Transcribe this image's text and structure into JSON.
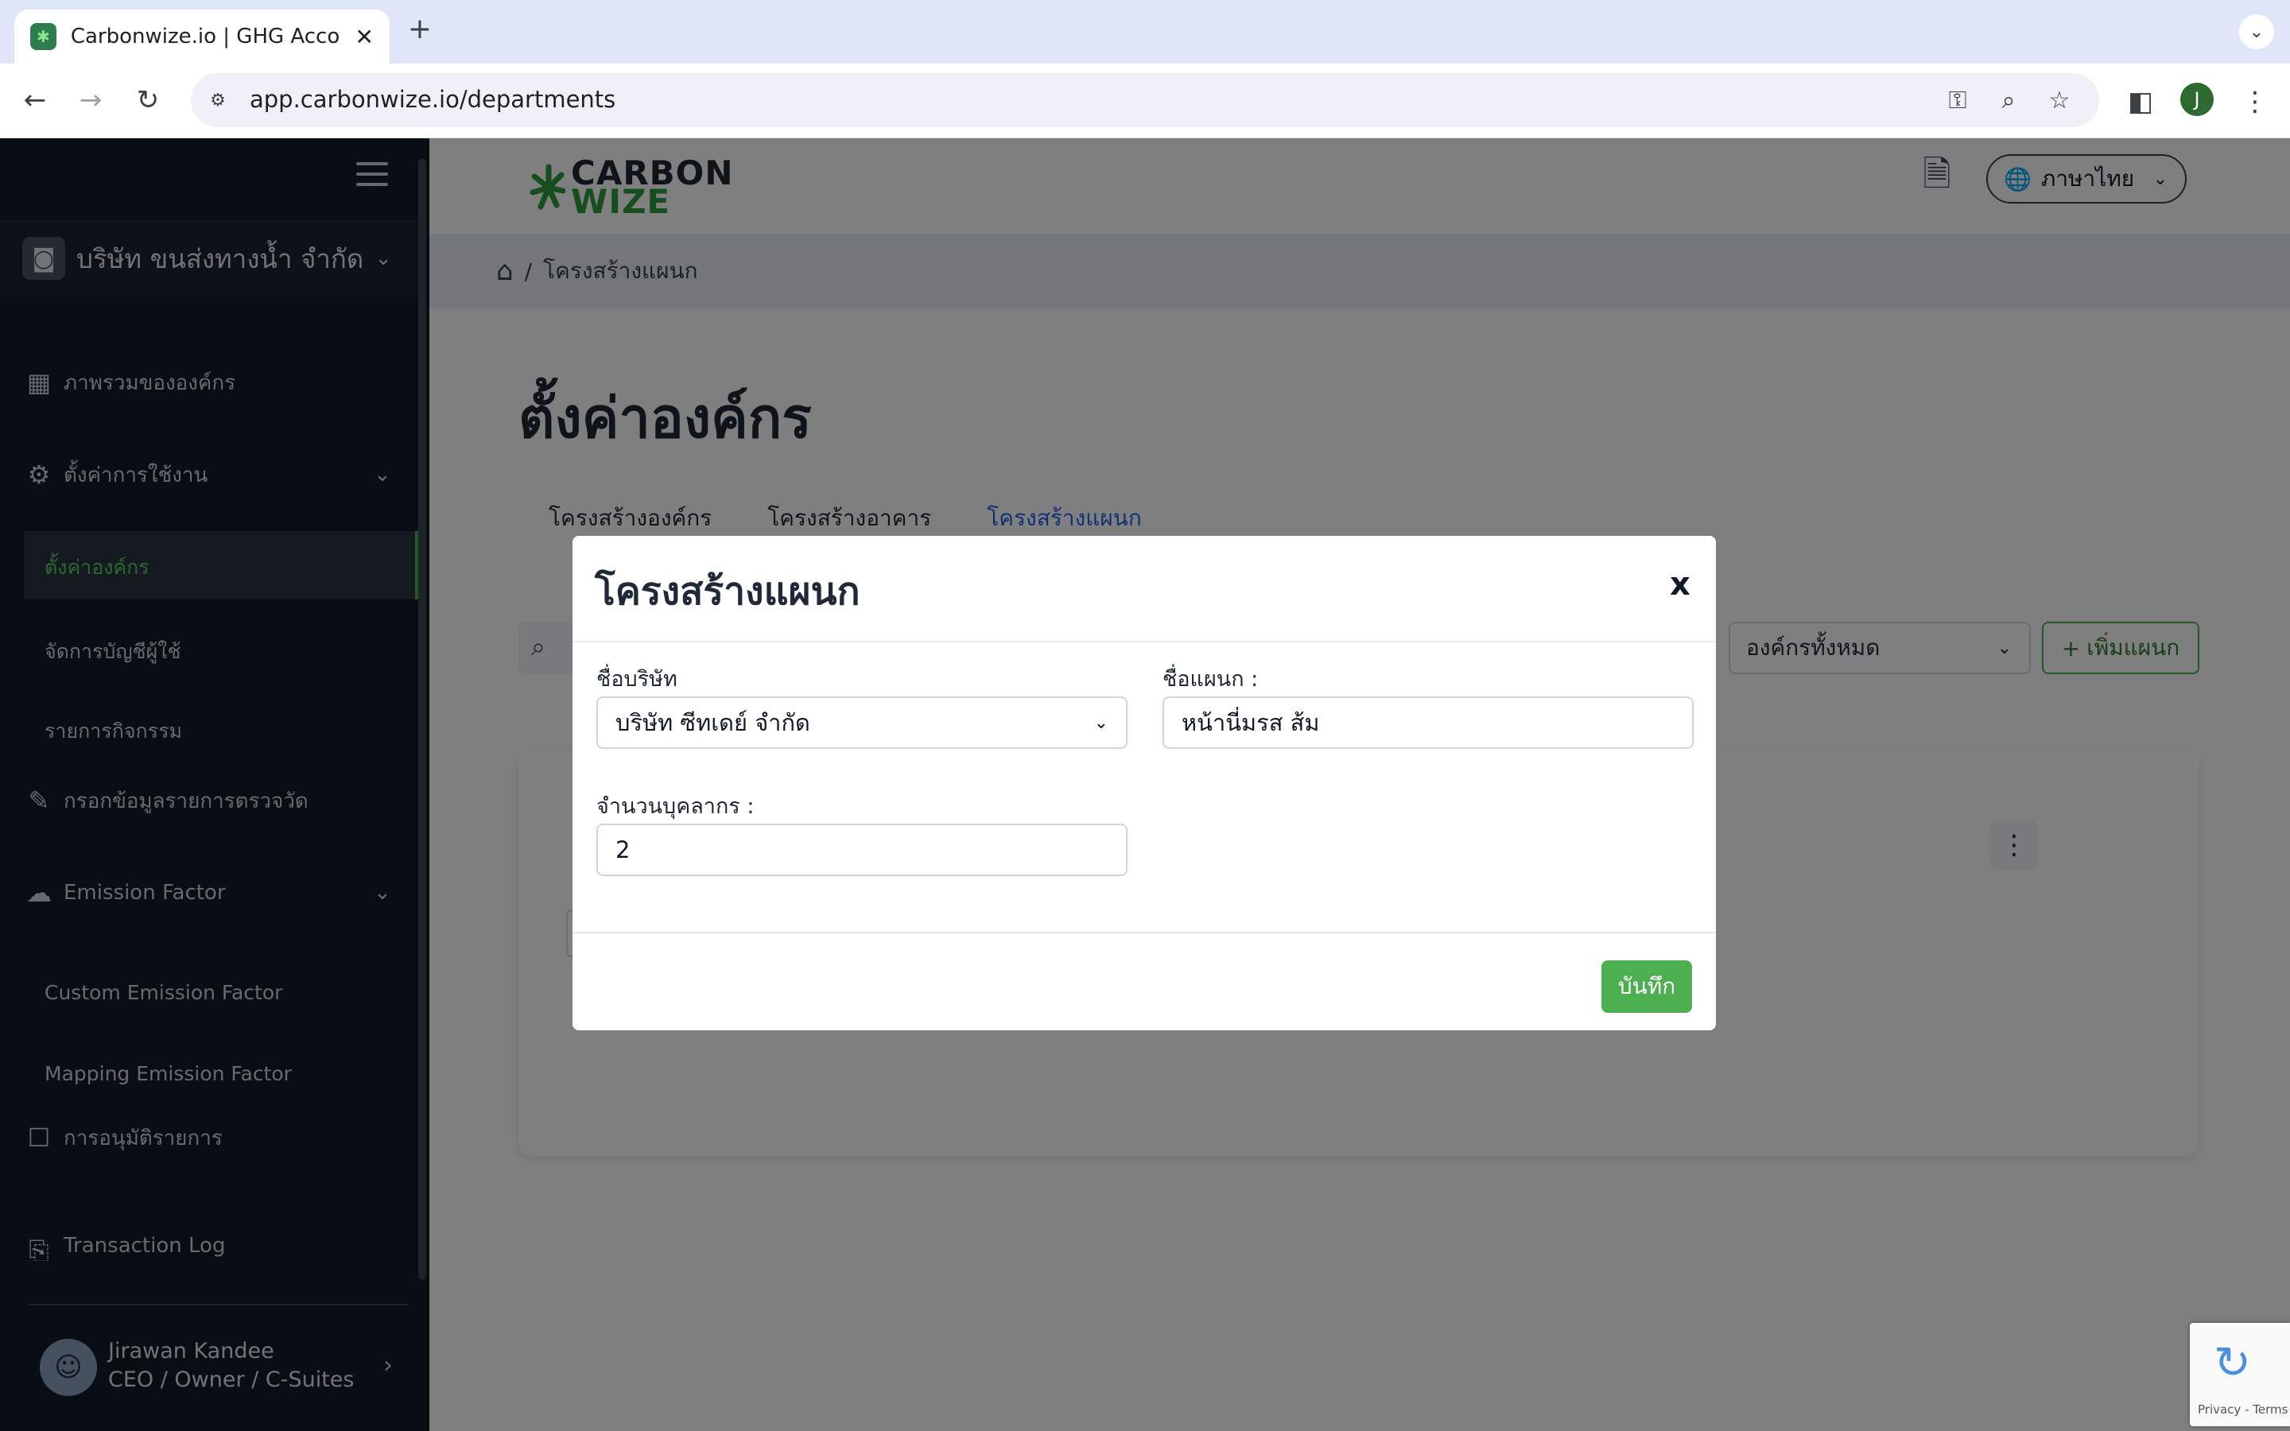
{
  "browser": {
    "tab_title": "Carbonwize.io | GHG Accoun",
    "url": "app.carbonwize.io/departments",
    "profile_initial": "J"
  },
  "sidebar": {
    "company_name": "บริษัท ขนส่งทางน้ำ จำกัด",
    "items": [
      {
        "label": "ภาพรวมขององค์กร",
        "icon": "layout-icon"
      },
      {
        "label": "ตั้งค่าการใช้งาน",
        "icon": "gear-icon"
      },
      {
        "label": "กรอกข้อมูลรายการตรวจวัด",
        "icon": "pencil-icon"
      },
      {
        "label": "Emission Factor",
        "icon": "cloud-icon"
      },
      {
        "label": "การอนุมัติรายการ",
        "icon": "approval-icon"
      },
      {
        "label": "Transaction Log",
        "icon": "clipboard-icon"
      }
    ],
    "sub_settings": [
      "ตั้งค่าองค์กร",
      "จัดการบัญชีผู้ใช้",
      "รายการกิจกรรม"
    ],
    "sub_emission": [
      "Custom Emission Factor",
      "Mapping Emission Factor"
    ],
    "user_name": "Jirawan Kandee",
    "user_role": "CEO / Owner / C-Suites"
  },
  "header": {
    "logo_line1": "CARBON",
    "logo_line2": "WIZE",
    "language": "ภาษาไทย"
  },
  "breadcrumb": {
    "separator": "/",
    "current": "โครงสร้างแผนก"
  },
  "page": {
    "title": "ตั้งค่าองค์กร",
    "tabs": [
      "โครงสร้างองค์กร",
      "โครงสร้างอาคาร",
      "โครงสร้างแผนก"
    ],
    "active_tab": "โครงสร้างแผนก",
    "filter_value": "องค์กรทั้งหมด",
    "add_button": "เพิ่มแผนก"
  },
  "modal": {
    "title": "โครงสร้างแผนก",
    "close": "x",
    "company_label": "ชื่อบริษัท",
    "company_value": "บริษัท ซีทเดย์ จำกัด",
    "department_label": "ชื่อแผนก :",
    "department_value": "หน้านี่มรส ส้ม",
    "headcount_label": "จำนวนบุคลากร :",
    "headcount_value": "2",
    "save_button": "บันทึก"
  },
  "recaptcha": {
    "text": "Privacy - Terms"
  },
  "colors": {
    "accent_green": "#4caf50",
    "sidebar_bg": "#131c28",
    "active_tab_blue": "#2563eb"
  }
}
